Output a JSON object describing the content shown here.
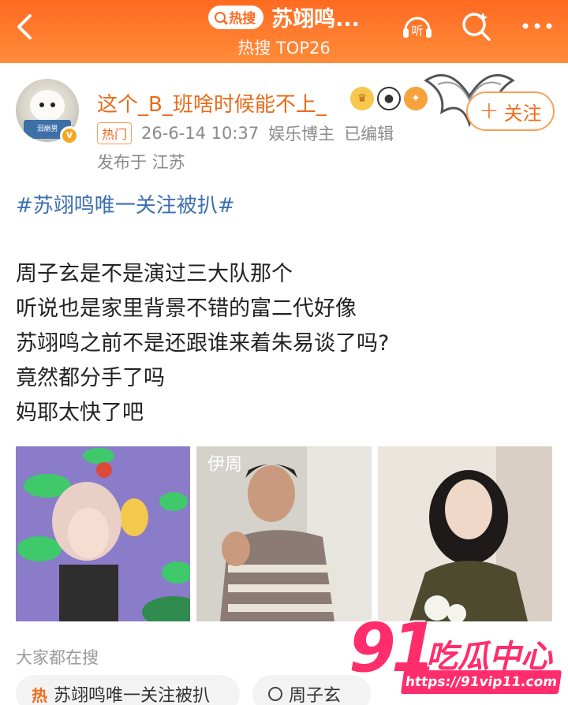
{
  "header": {
    "hot_label": "热搜",
    "title": "苏翊鸣...",
    "subtitle": "热搜 TOP26",
    "listen_label": "听"
  },
  "post": {
    "username": "这个_B_班啥时候能不上_",
    "follow_label": "关注",
    "hot_tag": "热门",
    "timestamp": "26-6-14 10:37",
    "role": "娱乐博主",
    "edited": "已编辑",
    "location": "发布于 江苏",
    "topic": "#苏翊鸣唯一关注被扒#",
    "lines": [
      "周子玄是不是演过三大队那个",
      "听说也是家里背景不错的富二代好像",
      "苏翊鸣之前不是还跟谁来着朱易谈了吗?",
      "竟然都分手了吗",
      "妈耶太快了吧"
    ],
    "avatar_text": "泪崩男",
    "photo2_text": "伊周"
  },
  "search": {
    "label": "大家都在搜",
    "chips": [
      "苏翊鸣唯一关注被扒",
      "周子玄"
    ]
  },
  "watermark": {
    "number": "91",
    "text": "吃瓜中心",
    "url": "https://91vip11.com"
  },
  "colors": {
    "header": "#ff6a21",
    "accent": "#f26b1d",
    "topic": "#3b6fb0",
    "watermark": "#ff2d6b"
  }
}
